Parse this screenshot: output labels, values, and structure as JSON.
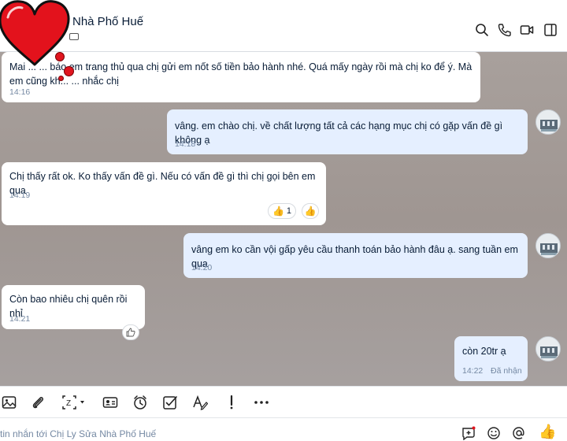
{
  "header": {
    "title": "Nhà Phố Huế"
  },
  "messages": [
    {
      "direction": "in",
      "lines": [
        "Mai ... ... báo em trang thủ qua chị gửi em nốt số tiền bảo hành nhé. Quá mấy ngày rồi mà chị ko để ý. Mà",
        "em cũng kh... ... nhắc chị"
      ],
      "time": "14:16"
    },
    {
      "direction": "out",
      "text": "vâng. em chào chị. về chất lượng tất cả các hạng mục chị có gặp vấn đề gì không ạ",
      "time": "14:18"
    },
    {
      "direction": "in",
      "text": "Chị thấy rất ok. Ko thấy vấn đề gì. Nếu có vấn đề gì thì chị gọi bên em qua",
      "time": "14:19",
      "reaction_count": "1"
    },
    {
      "direction": "out",
      "text": "vâng em ko cần vội gấp yêu cầu thanh toán bảo hành đâu ạ. sang tuần em qua",
      "time": "14:20"
    },
    {
      "direction": "in",
      "text": "Còn bao nhiêu chị quên rồi nhỉ",
      "time": "14:21"
    },
    {
      "direction": "out",
      "text": "còn 20tr ạ",
      "time": "14:22",
      "status": "Đã nhận"
    }
  ],
  "toolbar": {
    "icons": [
      "image-icon",
      "attachment-icon",
      "screenshot-icon",
      "contact-card-icon",
      "reminder-icon",
      "task-icon",
      "text-format-icon",
      "important-icon",
      "more-icon"
    ]
  },
  "input": {
    "placeholder": "tin nhắn tới Chị Ly Sửa Nhà Phố Huế"
  },
  "colors": {
    "chat_background": "#a39b98",
    "incoming_bubble": "#ffffff",
    "outgoing_bubble": "#e5efff",
    "like_yellow": "#f4b53c"
  }
}
